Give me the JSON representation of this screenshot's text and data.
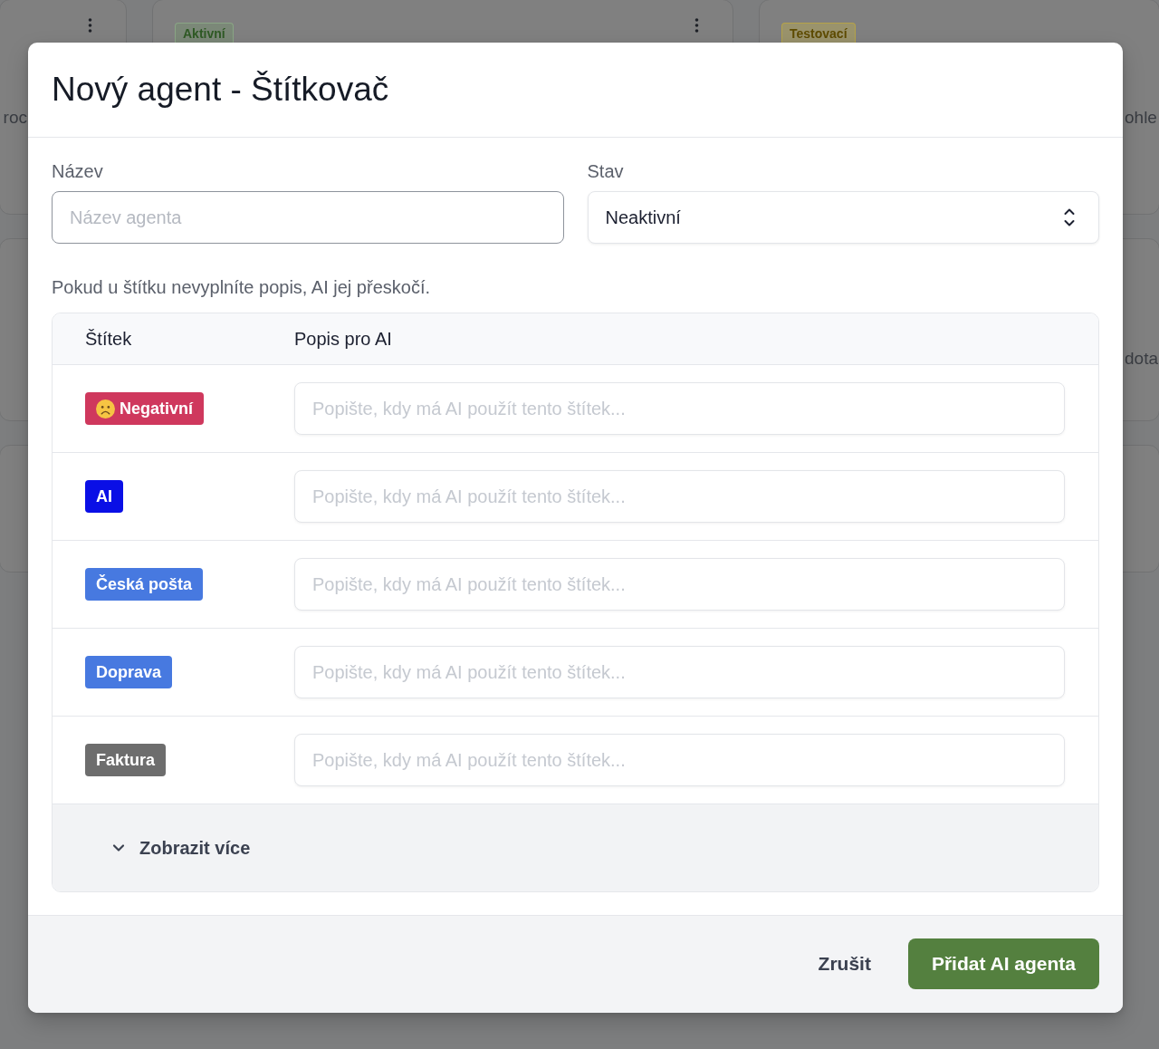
{
  "background": {
    "columns": [
      {
        "menu": true,
        "texts": [
          "roc"
        ]
      },
      {
        "menu": true,
        "badge": {
          "label": "Aktivní",
          "kind": "active"
        }
      },
      {
        "badge": {
          "label": "Testovací",
          "kind": "testing"
        },
        "texts": [
          "ohle",
          "dota"
        ]
      }
    ]
  },
  "dialog": {
    "title": "Nový agent - Štítkovač",
    "fields": [
      {
        "kind": "text",
        "label": "Název",
        "placeholder": "Název agenta"
      },
      {
        "kind": "select",
        "label": "Stav",
        "value": "Neaktivní"
      }
    ],
    "hint": "Pokud u štítku nevyplníte popis, AI jej přeskočí.",
    "table": {
      "columns": [
        "Štítek",
        "Popis pro AI"
      ],
      "rows": [
        {
          "tag": {
            "label": "Negativní",
            "color": "#cf385d",
            "kind": "emoji"
          },
          "placeholder": "Popište, kdy má AI použít tento štítek..."
        },
        {
          "tag": {
            "label": "AI",
            "color": "#0a0fe6",
            "kind": "plain"
          },
          "placeholder": "Popište, kdy má AI použít tento štítek..."
        },
        {
          "tag": {
            "label": "Česká pošta",
            "color": "#4779e0",
            "kind": "plain"
          },
          "placeholder": "Popište, kdy má AI použít tento štítek..."
        },
        {
          "tag": {
            "label": "Doprava",
            "color": "#4779e0",
            "kind": "plain"
          },
          "placeholder": "Popište, kdy má AI použít tento štítek..."
        },
        {
          "tag": {
            "label": "Faktura",
            "color": "#6d6d6d",
            "kind": "plain"
          },
          "placeholder": "Popište, kdy má AI použít tento štítek..."
        }
      ],
      "show_more": "Zobrazit více"
    },
    "buttons": [
      {
        "label": "Zrušit",
        "kind": "secondary"
      },
      {
        "label": "Přidat AI agenta",
        "kind": "primary"
      }
    ]
  }
}
